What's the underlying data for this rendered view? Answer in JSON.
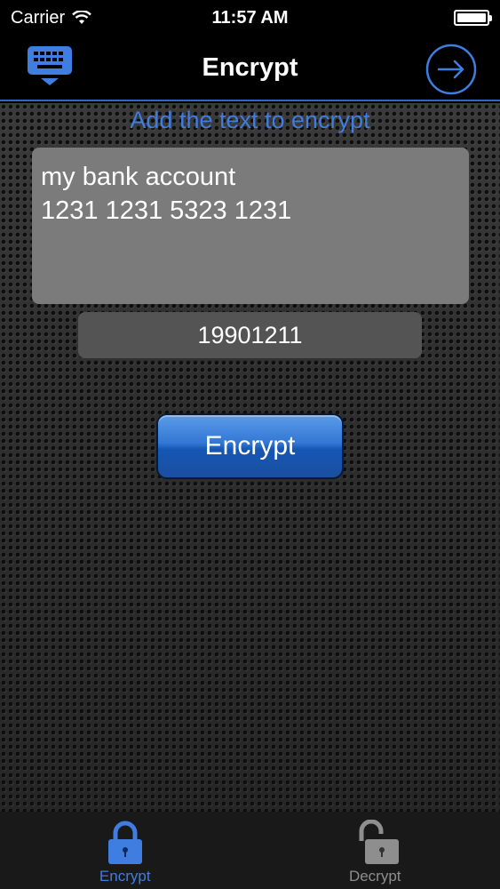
{
  "status_bar": {
    "carrier": "Carrier",
    "time": "11:57 AM"
  },
  "nav": {
    "title": "Encrypt",
    "left_icon": "keyboard-icon",
    "right_icon": "arrow-right-circle-icon"
  },
  "main": {
    "instruction": "Add the text to encrypt",
    "text_value": "my bank account\n1231 1231 5323 1231",
    "key_value": "19901211",
    "encrypt_label": "Encrypt"
  },
  "tabs": [
    {
      "label": "Encrypt",
      "icon": "lock-closed-icon",
      "active": true
    },
    {
      "label": "Decrypt",
      "icon": "lock-open-icon",
      "active": false
    }
  ],
  "colors": {
    "accent": "#3f7de0",
    "tab_inactive": "#8e8e8e"
  }
}
